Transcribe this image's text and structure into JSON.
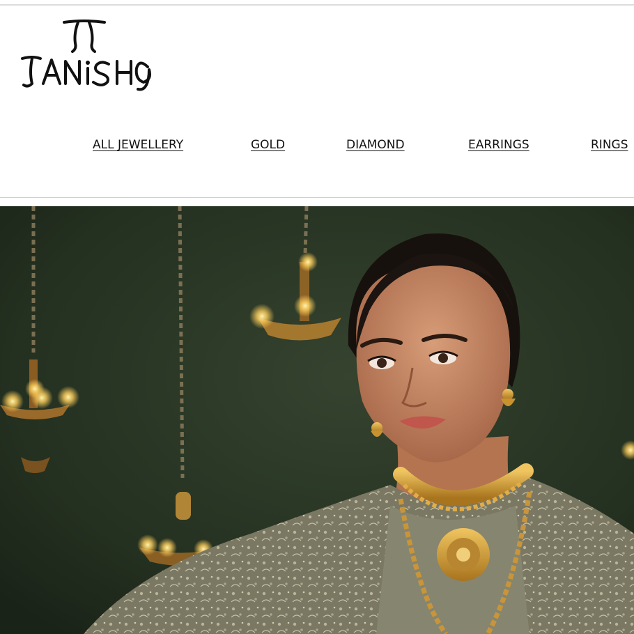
{
  "brand": {
    "name": "TANISHQ",
    "logo_letters": [
      "T",
      "A",
      "N",
      "I",
      "S",
      "H",
      "Q"
    ]
  },
  "nav": {
    "items": [
      {
        "label": "ALL JEWELLERY"
      },
      {
        "label": "GOLD"
      },
      {
        "label": "DIAMOND"
      },
      {
        "label": "EARRINGS"
      },
      {
        "label": "RINGS"
      }
    ]
  },
  "hero": {
    "description": "",
    "colors": {
      "background": "#2a3527",
      "gold": "#d4a33c",
      "lamp_glow": "#ffd87a",
      "skin": "#c98c6a",
      "hair": "#1a1411",
      "garment": "#7d7a66"
    }
  },
  "colors": {
    "text": "#111111",
    "header_bg": "#ffffff",
    "divider": "#cfcfcf"
  }
}
